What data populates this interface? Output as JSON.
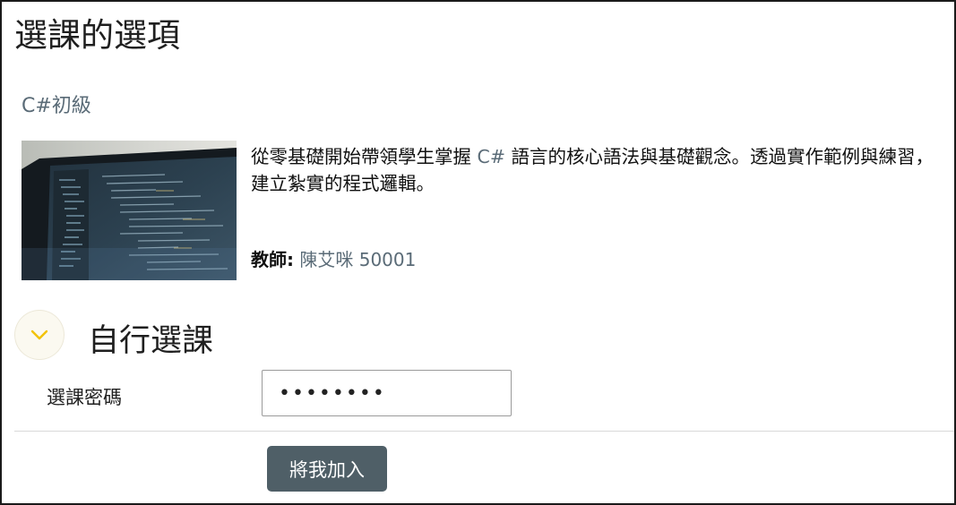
{
  "page": {
    "title": "選課的選項"
  },
  "course": {
    "name": "C#初級",
    "description_before": "從零基礎開始帶領學生掌握 ",
    "description_highlight": "C#",
    "description_after": " 語言的核心語法與基礎觀念。透過實作範例與練習，建立紮實的程式邏輯。",
    "teacher_label": "教師:",
    "teacher_name": "陳艾咪 50001"
  },
  "self_enrol": {
    "section_title": "自行選課",
    "toggle_icon": "chevron-down-icon",
    "password_label": "選課密碼",
    "password_value": "password",
    "join_button_label": "將我加入"
  },
  "colors": {
    "link": "#5a6b77",
    "button_bg": "#4f5f67",
    "toggle_chevron": "#f2c200"
  }
}
